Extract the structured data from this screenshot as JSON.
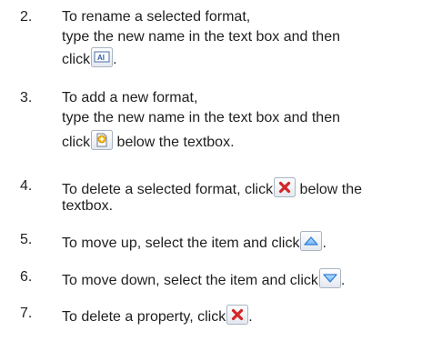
{
  "steps": [
    {
      "number": "2.",
      "line1": "To rename a selected format,",
      "line2": "type the new name in the text box and then",
      "line3_pre": "click",
      "line3_post": ".",
      "icon": "rename-format-icon"
    },
    {
      "number": "3.",
      "line1": "To add a new format,",
      "line2": "type the new name in the text box and then",
      "line3_pre": "click",
      "line3_post": " below the textbox.",
      "icon": "add-format-icon"
    },
    {
      "number": "4.",
      "line1_pre": "To delete a selected format, click",
      "line1_post": " below the",
      "line2": "textbox.",
      "icon": "delete-icon"
    },
    {
      "number": "5.",
      "line1_pre": "To move up, select the item and click",
      "line1_post": ".",
      "icon": "move-up-icon"
    },
    {
      "number": "6.",
      "line1_pre": "To move down, select the item and click",
      "line1_post": ".",
      "icon": "move-down-icon"
    },
    {
      "number": "7.",
      "line1_pre": "To delete a property, click",
      "line1_post": ".",
      "icon": "delete-icon"
    }
  ],
  "colors": {
    "text": "#1f1f1f",
    "icon_frame": "#a9b4c2",
    "delete_red": "#d42626",
    "arrow_blue": "#2f7fd6"
  }
}
